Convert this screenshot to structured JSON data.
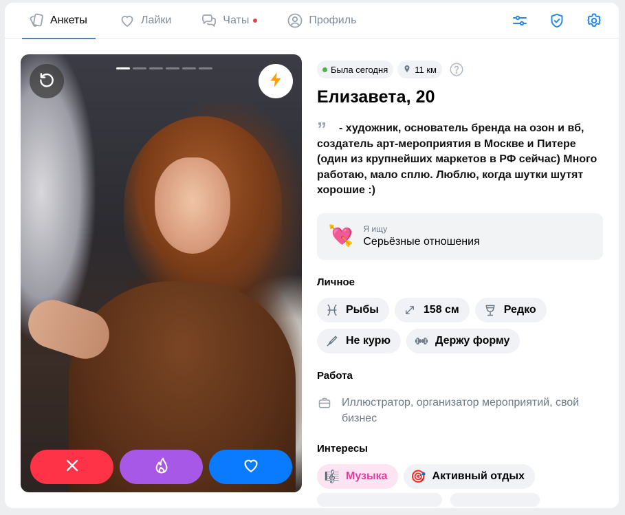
{
  "nav": {
    "tabs": [
      {
        "label": "Анкеты",
        "icon": "cards-icon"
      },
      {
        "label": "Лайки",
        "icon": "heart-outline-icon"
      },
      {
        "label": "Чаты",
        "icon": "chat-bubbles-icon"
      },
      {
        "label": "Профиль",
        "icon": "profile-icon"
      }
    ],
    "actions": [
      "filters-icon",
      "shield-check-icon",
      "gear-icon"
    ]
  },
  "photo": {
    "progress_total": 6,
    "progress_active": 1,
    "buttons": [
      "rewind-icon",
      "boost-lightning-icon",
      "close-icon",
      "flame-icon",
      "heart-icon"
    ]
  },
  "profile": {
    "status": "Была сегодня",
    "distance": "11 км",
    "name": "Елизавета, 20",
    "bio": "- художник, основатель бренда на озон и вб, создатель арт-мероприятия в Москве и Питере (один из крупнейших маркетов в РФ сейчас) Много работаю, мало сплю. Люблю, когда шутки шутят хорошие :)",
    "seeking": {
      "label": "Я ищу",
      "value": "Серьёзные отношения",
      "icon": "heart-with-arrow-emoji"
    }
  },
  "personal": {
    "title": "Личное",
    "tags": [
      {
        "label": "Рыбы",
        "icon": "pisces-icon"
      },
      {
        "label": "158 см",
        "icon": "height-arrows-icon"
      },
      {
        "label": "Редко",
        "icon": "wine-glass-icon"
      },
      {
        "label": "Не курю",
        "icon": "no-smoking-icon"
      },
      {
        "label": "Держу форму",
        "icon": "dumbbell-icon"
      }
    ]
  },
  "work": {
    "title": "Работа",
    "text": "Иллюстратор, организатор мероприятий, свой бизнес"
  },
  "interests": {
    "title": "Интересы",
    "tags": [
      {
        "label": "Музыка",
        "icon": "music-emoji",
        "selected": true
      },
      {
        "label": "Активный отдых",
        "icon": "target-emoji",
        "selected": false
      }
    ]
  },
  "colors": {
    "accent": "#5181b8",
    "nope": "#ff3347",
    "super": "#a858e6",
    "like": "#0a7aff",
    "online": "#4bb34b",
    "interest_selected": "#e23d9c"
  }
}
